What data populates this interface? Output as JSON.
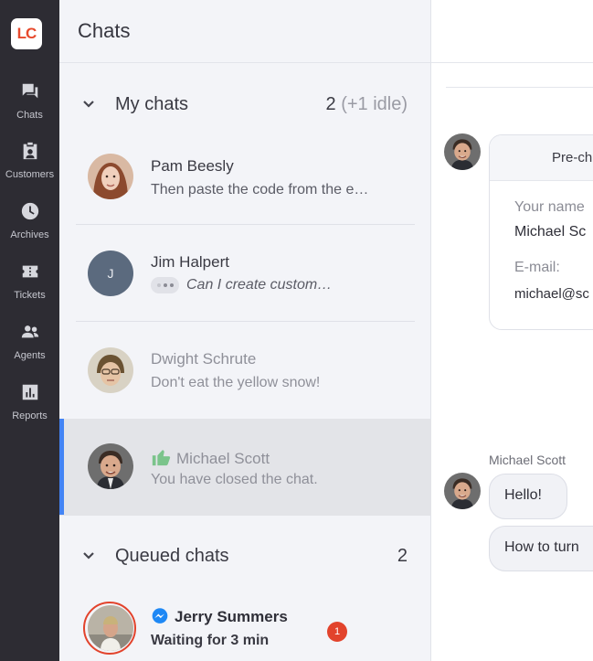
{
  "nav": {
    "logo": "LC",
    "items": [
      {
        "label": "Chats",
        "icon": "chats-icon"
      },
      {
        "label": "Customers",
        "icon": "customers-icon"
      },
      {
        "label": "Archives",
        "icon": "archives-icon"
      },
      {
        "label": "Tickets",
        "icon": "tickets-icon"
      },
      {
        "label": "Agents",
        "icon": "agents-icon"
      },
      {
        "label": "Reports",
        "icon": "reports-icon"
      }
    ]
  },
  "panel": {
    "title": "Chats",
    "my_chats": {
      "title": "My chats",
      "count": "2",
      "idle": "(+1 idle)",
      "rows": [
        {
          "name": "Pam Beesly",
          "message": "Then paste the code from the e…"
        },
        {
          "name": "Jim Halpert",
          "initial": "J",
          "message": "Can I create custom…"
        },
        {
          "name": "Dwight Schrute",
          "message": "Don't eat the yellow snow!"
        },
        {
          "name": "Michael Scott",
          "message": "You have closed the chat."
        }
      ]
    },
    "queued_chats": {
      "title": "Queued chats",
      "count": "2",
      "rows": [
        {
          "name": "Jerry Summers",
          "message": "Waiting for 3 min",
          "badge": "1"
        }
      ]
    }
  },
  "main": {
    "prechat": {
      "title": "Pre-ch",
      "name_label": "Your name",
      "name_value": "Michael Sc",
      "email_label": "E-mail:",
      "email_value": "michael@sc"
    },
    "sender": "Michael Scott",
    "messages": [
      "Hello!",
      "How to turn"
    ]
  },
  "colors": {
    "nav_bg": "#2d2c33",
    "panel_bg": "#f3f4f8",
    "active_bar": "#4384f5",
    "badge": "#e2432c",
    "thumb": "#7bc48b"
  }
}
